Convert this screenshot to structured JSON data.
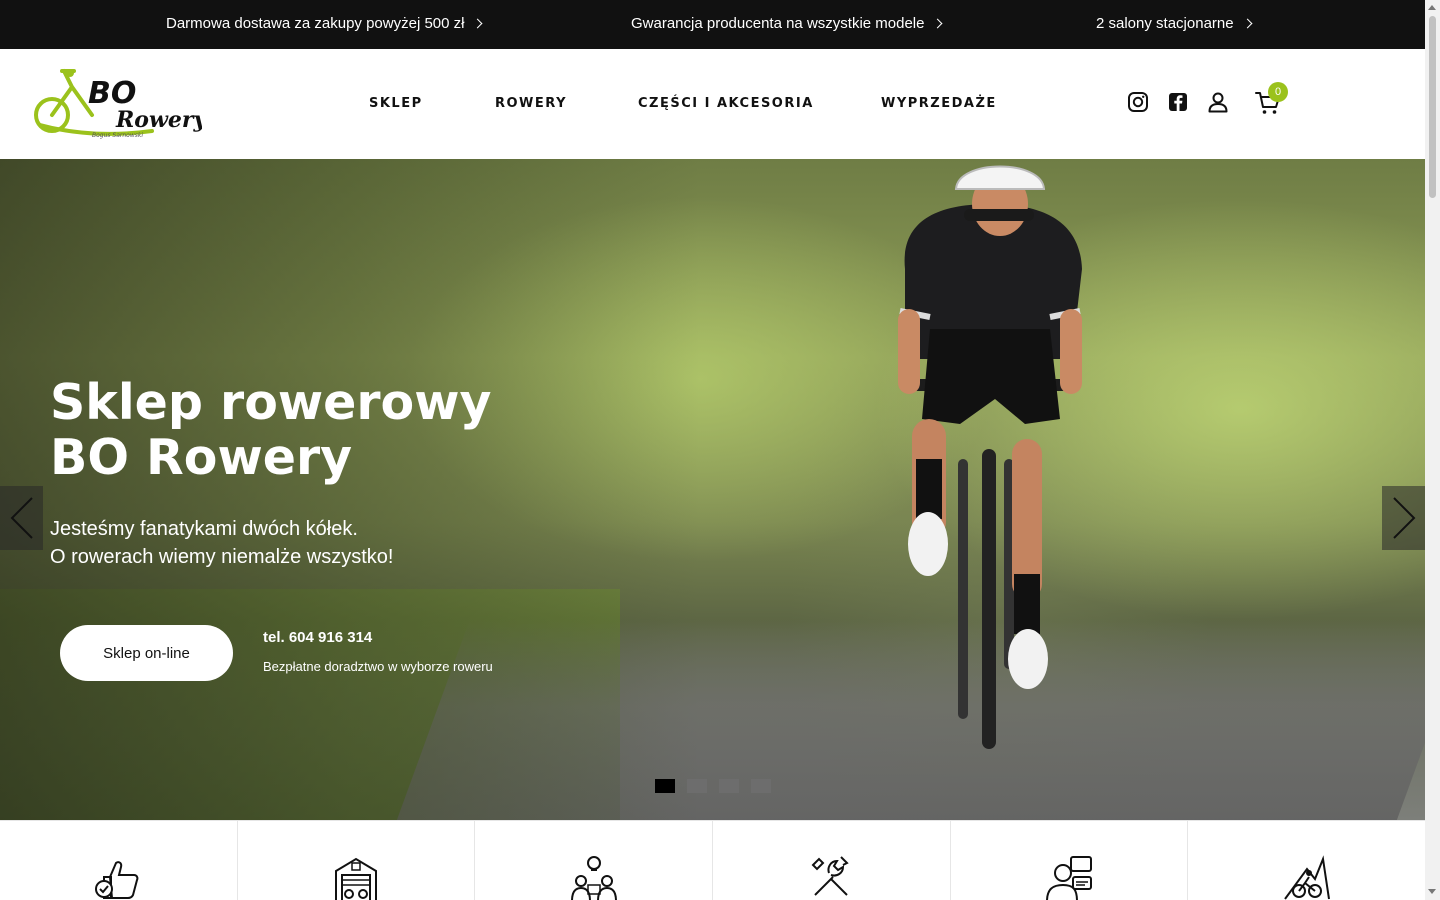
{
  "promo": [
    {
      "text": "Darmowa dostawa za zakupy powyżej 500 zł"
    },
    {
      "text": "Gwarancja producenta na wszystkie modele"
    },
    {
      "text": "2 salony stacjonarne"
    }
  ],
  "brand": {
    "logo_text_top": "BO",
    "logo_text_bottom": "Rowery",
    "logo_tagline": "Bogus Sarnowski",
    "accent": "#9bc21c"
  },
  "nav": [
    {
      "label": "SKLEP"
    },
    {
      "label": "ROWERY"
    },
    {
      "label": "CZĘŚCI I AKCESORIA"
    },
    {
      "label": "WYPRZEDAŻE"
    }
  ],
  "header_icons": [
    "instagram-icon",
    "facebook-icon",
    "user-icon",
    "cart-icon"
  ],
  "cart": {
    "count": "0"
  },
  "hero": {
    "title_line1": "Sklep rowerowy",
    "title_line2": "BO Rowery",
    "subtitle_line1": "Jesteśmy fanatykami dwóch kółek.",
    "subtitle_line2": "O rowerach wiemy niemalże wszystko!",
    "cta": "Sklep on-line",
    "phone": "tel. 604 916 314",
    "note": "Bezpłatne doradztwo w wyborze roweru",
    "slides": 4,
    "active_slide": 1
  },
  "features": [
    {
      "icon": "thumbs-up-check-icon"
    },
    {
      "icon": "bike-garage-icon"
    },
    {
      "icon": "advisor-idea-icon"
    },
    {
      "icon": "repair-tools-icon"
    },
    {
      "icon": "customer-support-icon"
    },
    {
      "icon": "mountain-bike-icon"
    }
  ]
}
